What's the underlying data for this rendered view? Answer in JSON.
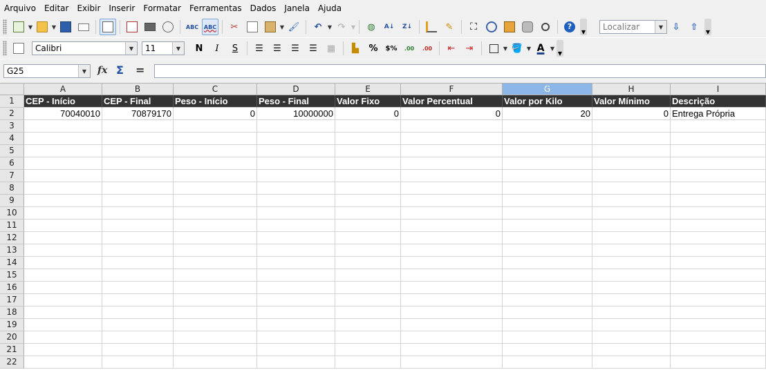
{
  "menu": [
    "Arquivo",
    "Editar",
    "Exibir",
    "Inserir",
    "Formatar",
    "Ferramentas",
    "Dados",
    "Janela",
    "Ajuda"
  ],
  "toolbar": {
    "search_placeholder": "Localizar",
    "font_name": "Calibri",
    "font_size": "11"
  },
  "formula_bar": {
    "name_box": "G25",
    "fx": "fx",
    "sum": "Σ",
    "equals": "=",
    "content": ""
  },
  "sheet": {
    "columns": [
      "A",
      "B",
      "C",
      "D",
      "E",
      "F",
      "G",
      "H",
      "I"
    ],
    "selected_column": "G",
    "rows": [
      "1",
      "2",
      "3",
      "4",
      "5",
      "6",
      "7",
      "8",
      "9",
      "10",
      "11",
      "12",
      "13",
      "14",
      "15",
      "16",
      "17",
      "18",
      "19",
      "20",
      "21",
      "22"
    ],
    "header_row": [
      "CEP - Início",
      "CEP - Final",
      "Peso - Início",
      "Peso - Final",
      "Valor Fixo",
      "Valor Percentual",
      "Valor por Kilo",
      "Valor Mínimo",
      "Descrição"
    ],
    "data_row": [
      "70040010",
      "70879170",
      "0",
      "10000000",
      "0",
      "0",
      "20",
      "0",
      "Entrega Própria"
    ]
  },
  "colors": {
    "header_fill": "#333333",
    "selected_column_header": "#8cb6e8",
    "toolbar_bg": "#f0f0f0"
  }
}
